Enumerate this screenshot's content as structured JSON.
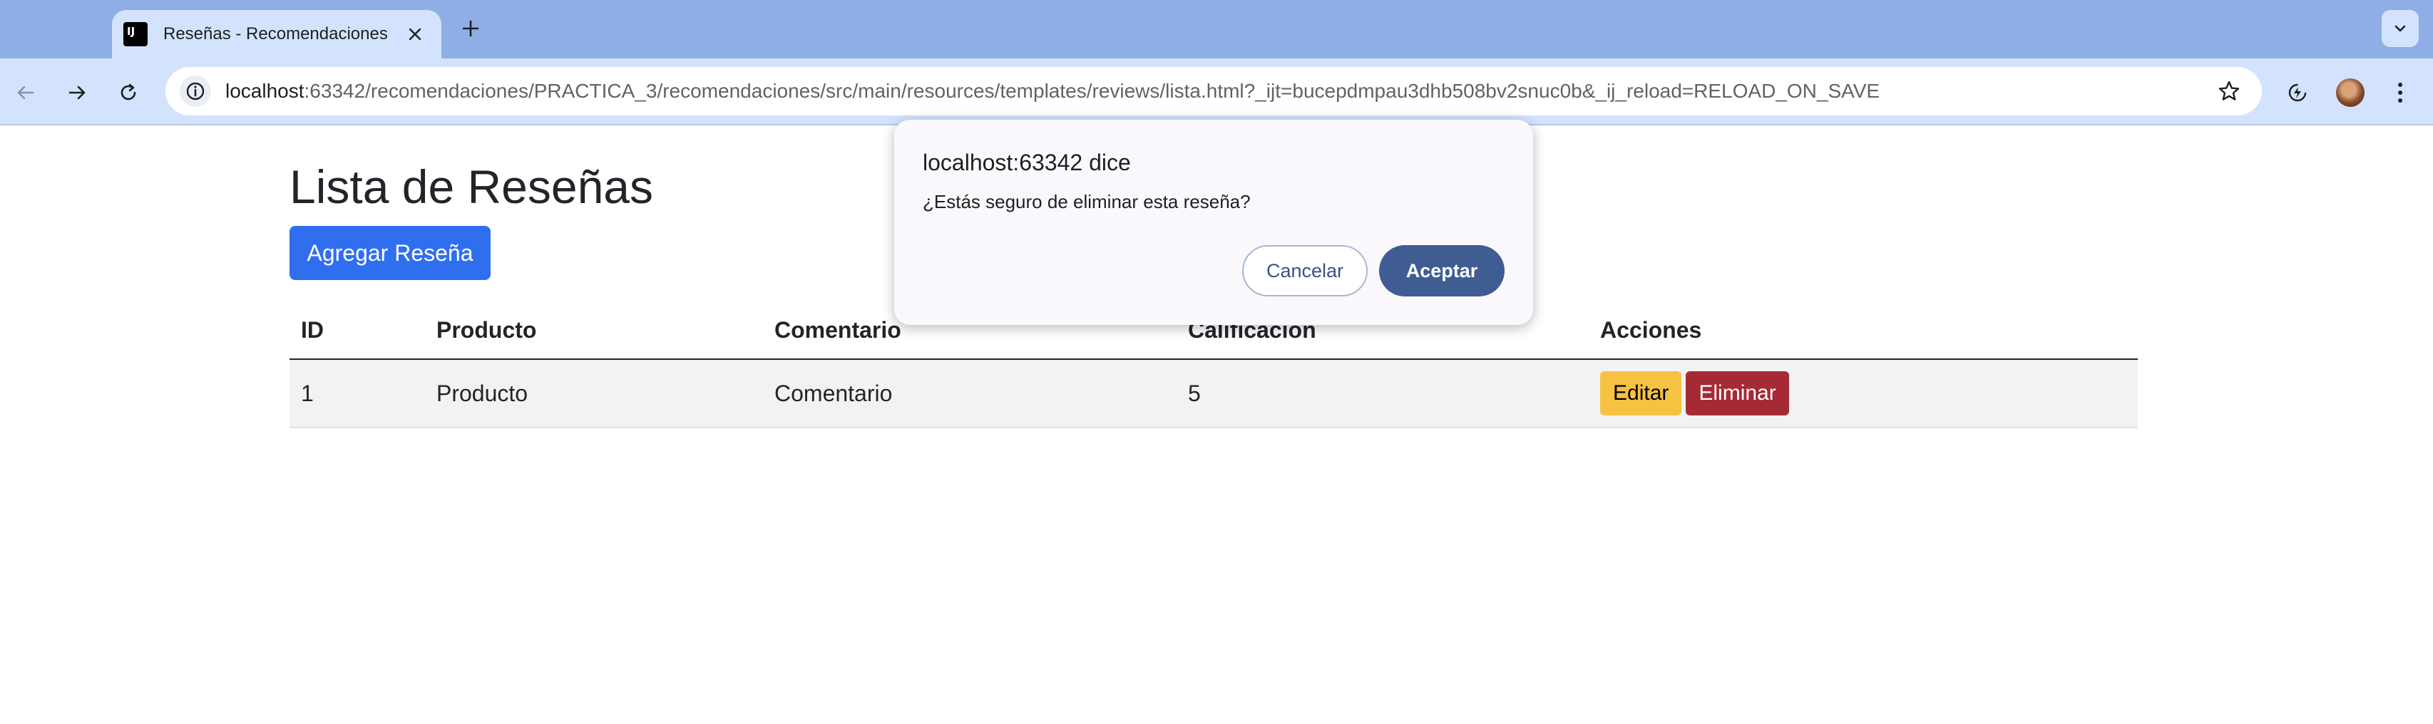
{
  "browser": {
    "tab": {
      "title": "Reseñas - Recomendaciones",
      "favicon_text": "IJ"
    },
    "url": {
      "host": "localhost",
      "rest": ":63342/recomendaciones/PRACTICA_3/recomendaciones/src/main/resources/templates/reviews/lista.html?_ijt=bucepdmpau3dhb508bv2snuc0b&_ij_reload=RELOAD_ON_SAVE"
    },
    "icons": [
      "back-arrow-icon",
      "forward-arrow-icon",
      "reload-icon",
      "site-info-icon",
      "star-icon",
      "extension-icon",
      "avatar",
      "kebab-menu-icon"
    ]
  },
  "page": {
    "title": "Lista de Reseñas",
    "add_button": "Agregar Reseña",
    "table": {
      "headers": [
        "ID",
        "Producto",
        "Comentario",
        "Calificación",
        "Acciones"
      ],
      "rows": [
        {
          "id": "1",
          "producto": "Producto",
          "comentario": "Comentario",
          "calificacion": "5"
        }
      ],
      "edit_label": "Editar",
      "delete_label": "Eliminar"
    }
  },
  "dialog": {
    "title": "localhost:63342 dice",
    "message": "¿Estás seguro de eliminar esta reseña?",
    "cancel_label": "Cancelar",
    "accept_label": "Aceptar"
  },
  "colors": {
    "primary": "#2f6fef",
    "warning": "#f5c242",
    "danger": "#a62a36",
    "dialog_accept": "#3f5d93",
    "chrome_tabstrip": "#8eaee5",
    "chrome_toolbar": "#d3e3fd"
  }
}
